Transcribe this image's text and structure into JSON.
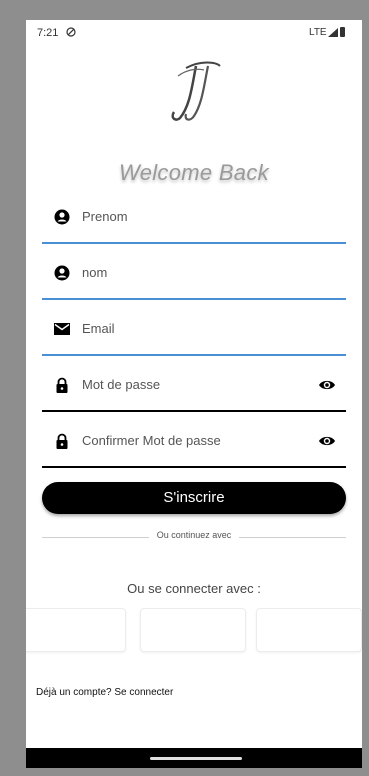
{
  "status_bar": {
    "time": "7:21",
    "network": "LTE"
  },
  "logo": {
    "icon": "jj-monogram-logo"
  },
  "header": {
    "title": "Welcome Back"
  },
  "form": {
    "first_name": {
      "placeholder": "Prenom",
      "icon": "person-icon"
    },
    "last_name": {
      "placeholder": "nom",
      "icon": "person-icon"
    },
    "email": {
      "placeholder": "Email",
      "icon": "mail-icon"
    },
    "password": {
      "placeholder": "Mot de passe",
      "icon": "lock-icon"
    },
    "confirm_password": {
      "placeholder": "Confirmer Mot de passe",
      "icon": "lock-icon"
    }
  },
  "signup_button": {
    "label": "S'inscrire"
  },
  "divider": {
    "text": "Ou continuez avec"
  },
  "social": {
    "title": "Ou se connecter avec :"
  },
  "login": {
    "text": "Déjà un compte? Se connecter"
  },
  "colors": {
    "accent": "#4a8fd6",
    "button": "#000000"
  }
}
